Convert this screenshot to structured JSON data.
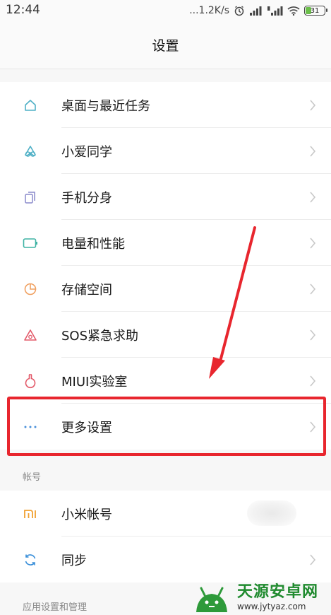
{
  "status": {
    "time": "12:44",
    "net_speed": "...1.2K/s",
    "battery": "31"
  },
  "header": {
    "title": "设置"
  },
  "main_items": [
    {
      "label": "桌面与最近任务",
      "icon": "home-icon",
      "color": "#4fb0c6"
    },
    {
      "label": "小爱同学",
      "icon": "xiaoai-icon",
      "color": "#4fb0c6"
    },
    {
      "label": "手机分身",
      "icon": "dual-phone-icon",
      "color": "#8a8acb"
    },
    {
      "label": "电量和性能",
      "icon": "battery-icon",
      "color": "#3fb3a4"
    },
    {
      "label": "存储空间",
      "icon": "storage-pie-icon",
      "color": "#f0a060"
    },
    {
      "label": "SOS紧急求助",
      "icon": "sos-warning-icon",
      "color": "#e35a6a"
    },
    {
      "label": "MIUI实验室",
      "icon": "flask-icon",
      "color": "#e35a6a"
    },
    {
      "label": "更多设置",
      "icon": "more-dots-icon",
      "color": "#4a90d9"
    }
  ],
  "account_section": {
    "header": "帐号",
    "items": [
      {
        "label": "小米帐号",
        "icon": "mi-logo-icon",
        "color": "#f0a030"
      },
      {
        "label": "同步",
        "icon": "sync-icon",
        "color": "#3a8fd9"
      }
    ]
  },
  "app_section": {
    "header": "应用设置和管理"
  },
  "watermark": {
    "title": "天源安卓网",
    "url": "www.jytyaz.com"
  },
  "highlight_color": "#e8262e"
}
